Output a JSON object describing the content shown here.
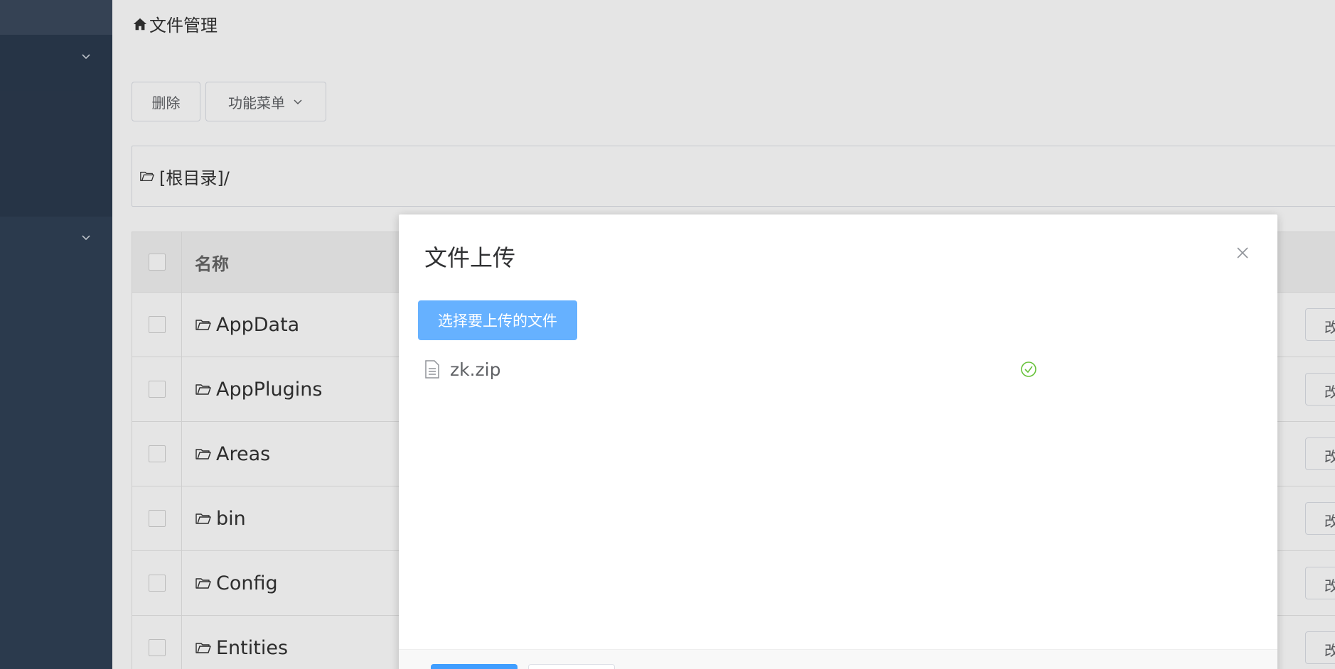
{
  "breadcrumb": {
    "title": "文件管理",
    "icon": "home-icon"
  },
  "toolbar": {
    "delete_label": "删除",
    "menu_label": "功能菜单"
  },
  "path": {
    "text": "[根目录]/"
  },
  "table": {
    "header_name": "名称",
    "rows": [
      {
        "name": "AppData",
        "action": "改"
      },
      {
        "name": "AppPlugins",
        "action": "改"
      },
      {
        "name": "Areas",
        "action": "改"
      },
      {
        "name": "bin",
        "action": "改"
      },
      {
        "name": "Config",
        "action": "改"
      },
      {
        "name": "Entities",
        "action": "改"
      }
    ]
  },
  "modal": {
    "title": "文件上传",
    "upload_button": "选择要上传的文件",
    "files": [
      {
        "name": "zk.zip",
        "status": "success"
      }
    ]
  },
  "colors": {
    "sidebar": "#304156",
    "primary": "#409eff",
    "primary_light": "#66b1ff",
    "success": "#67c23a"
  }
}
